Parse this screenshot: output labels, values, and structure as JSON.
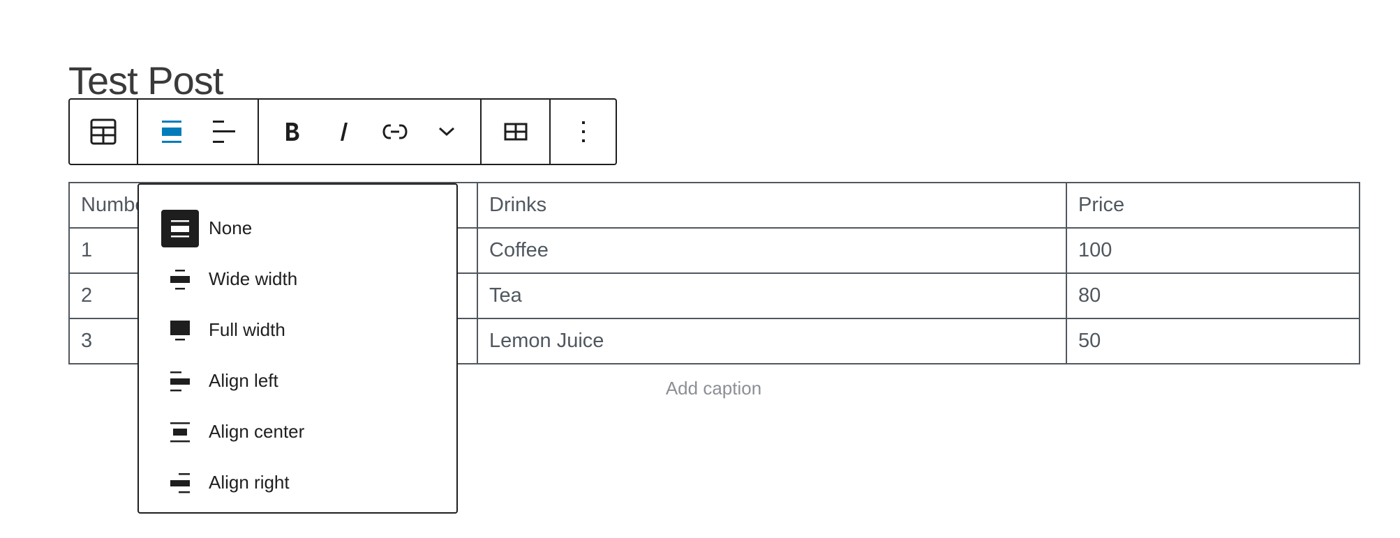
{
  "post": {
    "title": "Test Post"
  },
  "toolbar": {
    "groups": [
      {
        "items": [
          {
            "icon": "table-icon",
            "label": "Table"
          }
        ]
      },
      {
        "items": [
          {
            "icon": "align-none-icon",
            "label": "Align",
            "active": true
          },
          {
            "icon": "align-text-left-icon",
            "label": "Align text"
          }
        ]
      },
      {
        "items": [
          {
            "icon": "bold-icon",
            "label": "Bold"
          },
          {
            "icon": "italic-icon",
            "label": "Italic"
          },
          {
            "icon": "link-icon",
            "label": "Link"
          },
          {
            "icon": "chevron-down-icon",
            "label": "More"
          }
        ]
      },
      {
        "items": [
          {
            "icon": "table-grid-icon",
            "label": "Edit table"
          }
        ]
      },
      {
        "items": [
          {
            "icon": "more-vertical-icon",
            "label": "Options"
          }
        ]
      }
    ],
    "accent_color": "#007cba"
  },
  "table": {
    "headers": [
      "Number",
      "",
      "Drinks",
      "Price"
    ],
    "rows": [
      [
        "1",
        "",
        "Coffee",
        "100"
      ],
      [
        "2",
        "",
        "Tea",
        "80"
      ],
      [
        "3",
        "",
        "Lemon Juice",
        "50"
      ]
    ],
    "caption_placeholder": "Add caption"
  },
  "alignment_menu": {
    "items": [
      {
        "label": "None",
        "icon": "align-none-icon",
        "selected": true
      },
      {
        "label": "Wide width",
        "icon": "align-wide-icon",
        "selected": false
      },
      {
        "label": "Full width",
        "icon": "align-full-icon",
        "selected": false
      },
      {
        "label": "Align left",
        "icon": "align-left-icon",
        "selected": false
      },
      {
        "label": "Align center",
        "icon": "align-center-icon",
        "selected": false
      },
      {
        "label": "Align right",
        "icon": "align-right-icon",
        "selected": false
      }
    ]
  }
}
